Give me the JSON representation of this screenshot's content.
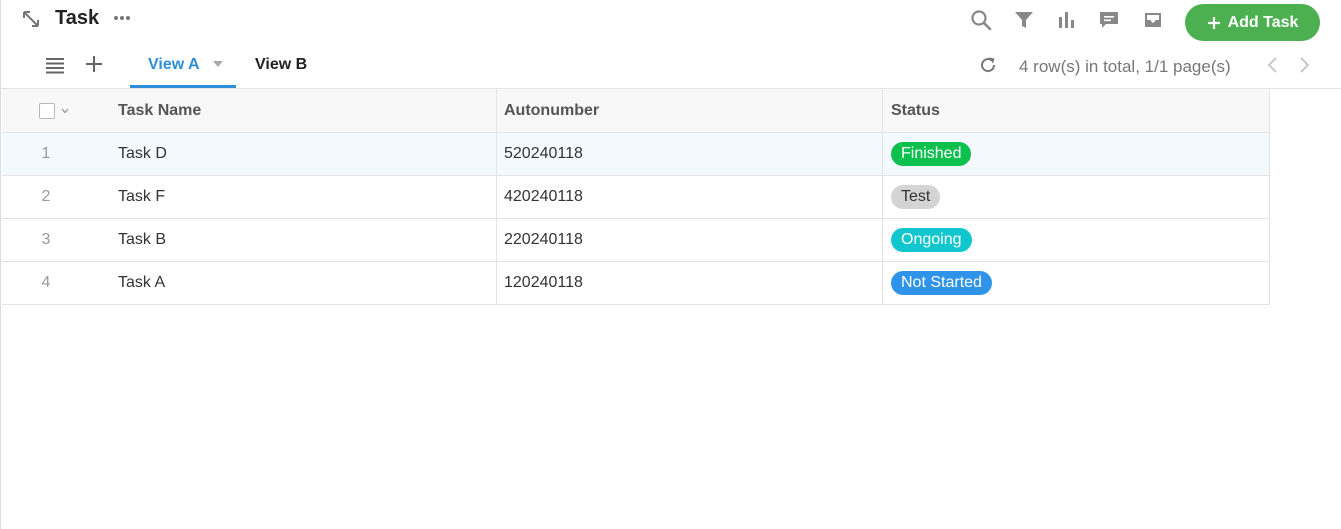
{
  "header": {
    "title": "Task",
    "add_task_label": "Add Task",
    "icons": [
      "expand-icon",
      "more-icon",
      "search-icon",
      "filter-icon",
      "chart-icon",
      "comment-icon",
      "inbox-icon"
    ],
    "accent_color": "#4cb050"
  },
  "toolbar": {
    "tabs": [
      {
        "label": "View A",
        "active": true
      },
      {
        "label": "View B",
        "active": false
      }
    ],
    "rows_info": "4 row(s) in total, 1/1 page(s)",
    "active_tab_color": "#2e8fd8"
  },
  "table": {
    "columns": [
      "Task Name",
      "Autonumber",
      "Status"
    ],
    "rows": [
      {
        "index": "1",
        "name": "Task D",
        "autonumber": "520240118",
        "status": "Finished",
        "status_color": "#0cc04e",
        "status_text_color": "#ffffff"
      },
      {
        "index": "2",
        "name": "Task F",
        "autonumber": "420240118",
        "status": "Test",
        "status_color": "#d4d4d4",
        "status_text_color": "#333333"
      },
      {
        "index": "3",
        "name": "Task B",
        "autonumber": "220240118",
        "status": "Ongoing",
        "status_color": "#11c6cc",
        "status_text_color": "#ffffff"
      },
      {
        "index": "4",
        "name": "Task A",
        "autonumber": "120240118",
        "status": "Not Started",
        "status_color": "#2f93ea",
        "status_text_color": "#ffffff"
      }
    ]
  }
}
